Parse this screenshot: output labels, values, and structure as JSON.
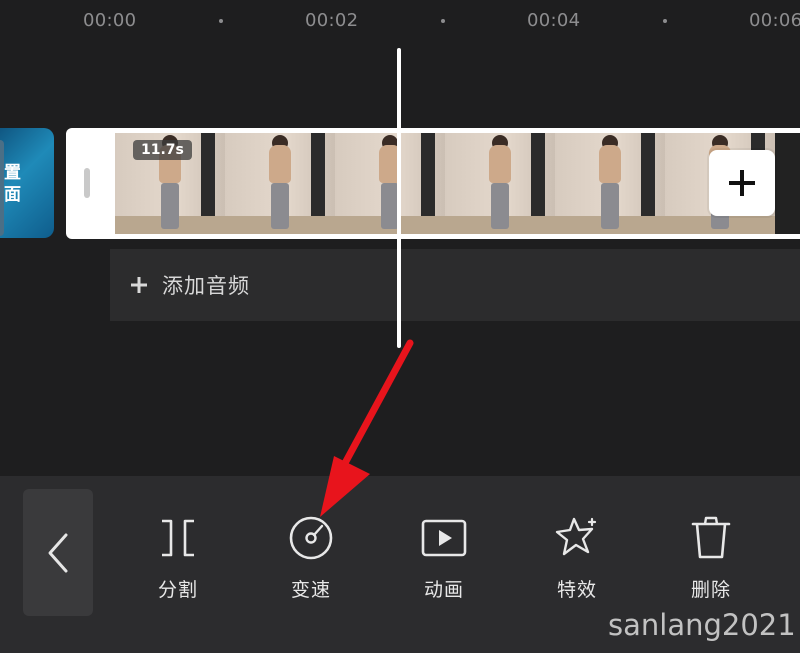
{
  "ruler": {
    "ticks": [
      "00:00",
      "00:02",
      "00:04",
      "00:06"
    ]
  },
  "cover": {
    "text_line1": "置",
    "text_line2": "面"
  },
  "video_clip": {
    "duration": "11.7s"
  },
  "audio_track": {
    "add_label": "添加音频"
  },
  "toolbar": {
    "tools": [
      {
        "label": "分割",
        "icon": "split-icon"
      },
      {
        "label": "变速",
        "icon": "speed-icon"
      },
      {
        "label": "动画",
        "icon": "animation-icon"
      },
      {
        "label": "特效",
        "icon": "effects-icon"
      },
      {
        "label": "删除",
        "icon": "delete-icon"
      }
    ]
  },
  "annotation": {
    "arrow_color": "#e8141c"
  },
  "watermark": "sanlang2021"
}
